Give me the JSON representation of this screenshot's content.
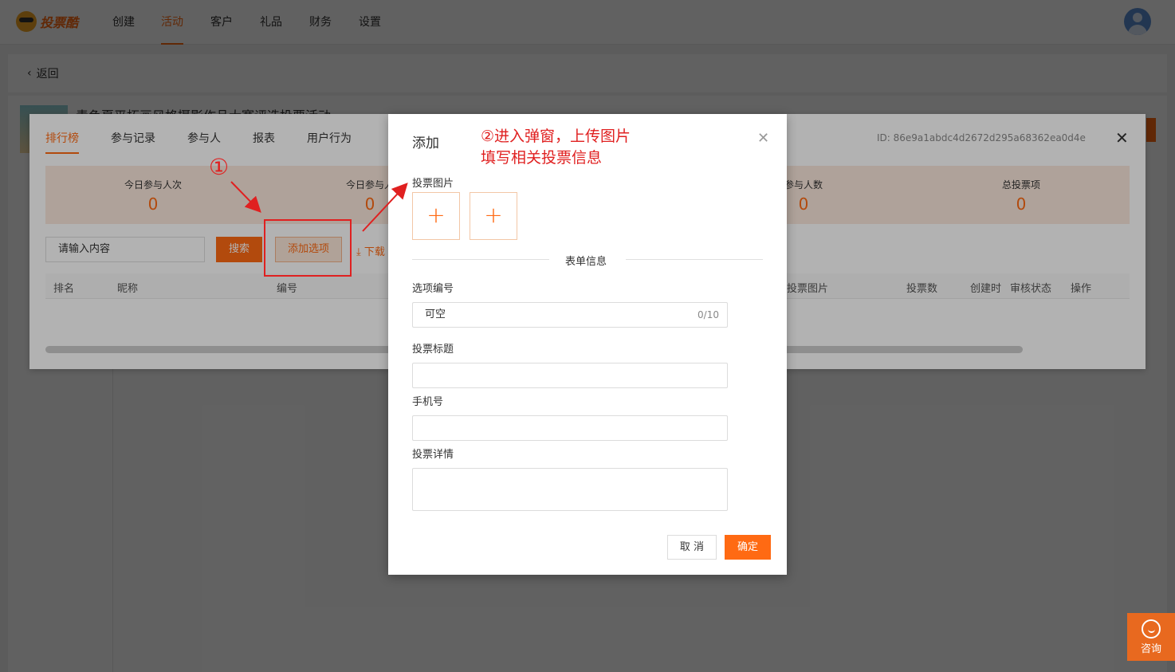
{
  "app": {
    "logo_text": "投票酷"
  },
  "nav": {
    "items": [
      "创建",
      "活动",
      "客户",
      "礼品",
      "财务",
      "设置"
    ],
    "active_index": 1
  },
  "back": {
    "label": "返回"
  },
  "activity": {
    "title": "青色夏平拓画风格摄影作品大赛评选投票活动"
  },
  "ranking_modal": {
    "tabs": [
      "排行榜",
      "参与记录",
      "参与人",
      "报表",
      "用户行为"
    ],
    "active_tab": 0,
    "id_text": "ID: 86e9a1abdc4d2672d295a68362ea0d4e",
    "stats": [
      {
        "label": "今日参与人次",
        "value": "0"
      },
      {
        "label": "今日参与人",
        "value": "0"
      },
      {
        "label": "参与人数",
        "value": "0"
      },
      {
        "label": "总投票项",
        "value": "0"
      }
    ],
    "search_placeholder": "请输入内容",
    "search_button": "搜索",
    "add_option_button": "添加选项",
    "download_label": "下载",
    "columns": [
      "排名",
      "昵称",
      "编号",
      "投票图片",
      "投票数",
      "创建时",
      "审核状态",
      "操作"
    ]
  },
  "add_modal": {
    "title": "添加",
    "image_label": "投票图片",
    "divider": "表单信息",
    "fields": {
      "option_number": {
        "label": "选项编号",
        "placeholder": "可空",
        "counter": "0/10"
      },
      "vote_title": {
        "label": "投票标题"
      },
      "phone": {
        "label": "手机号"
      },
      "detail": {
        "label": "投票详情"
      }
    },
    "cancel": "取 消",
    "confirm": "确定"
  },
  "annotations": {
    "step1": "①",
    "step2_line1": "②进入弹窗，上传图片",
    "step2_line2": "填写相关投票信息"
  },
  "consult": {
    "label": "咨询"
  },
  "colors": {
    "accent": "#ff6a13",
    "annotation": "#e02020"
  }
}
